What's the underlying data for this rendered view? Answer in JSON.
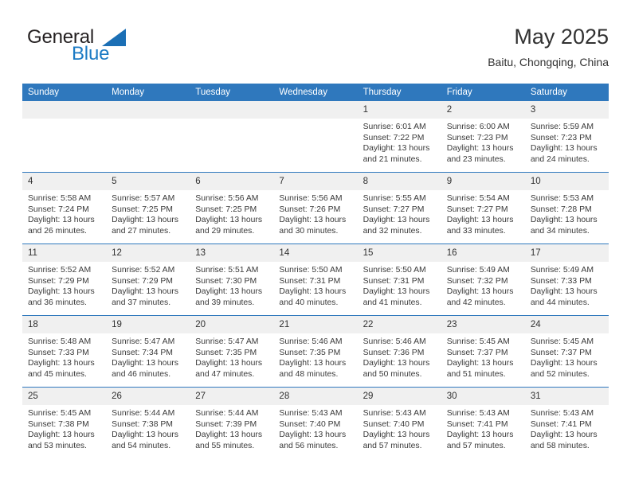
{
  "brand": {
    "word1": "General",
    "word2": "Blue",
    "triangle_color": "#1b6fb5"
  },
  "header": {
    "title": "May 2025",
    "subtitle": "Baitu, Chongqing, China"
  },
  "theme": {
    "header_blue": "#2f78bd",
    "daynum_gray": "#f0f0f0",
    "text": "#3a3a3a"
  },
  "weekdays": [
    "Sunday",
    "Monday",
    "Tuesday",
    "Wednesday",
    "Thursday",
    "Friday",
    "Saturday"
  ],
  "labels": {
    "sunrise_prefix": "Sunrise:",
    "sunset_prefix": "Sunset:",
    "daylight_prefix": "Daylight:"
  },
  "weeks": [
    [
      {
        "day": "",
        "sunrise": "",
        "sunset": "",
        "daylight_line1": "",
        "daylight_line2": ""
      },
      {
        "day": "",
        "sunrise": "",
        "sunset": "",
        "daylight_line1": "",
        "daylight_line2": ""
      },
      {
        "day": "",
        "sunrise": "",
        "sunset": "",
        "daylight_line1": "",
        "daylight_line2": ""
      },
      {
        "day": "",
        "sunrise": "",
        "sunset": "",
        "daylight_line1": "",
        "daylight_line2": ""
      },
      {
        "day": "1",
        "sunrise": "Sunrise: 6:01 AM",
        "sunset": "Sunset: 7:22 PM",
        "daylight_line1": "Daylight: 13 hours",
        "daylight_line2": "and 21 minutes."
      },
      {
        "day": "2",
        "sunrise": "Sunrise: 6:00 AM",
        "sunset": "Sunset: 7:23 PM",
        "daylight_line1": "Daylight: 13 hours",
        "daylight_line2": "and 23 minutes."
      },
      {
        "day": "3",
        "sunrise": "Sunrise: 5:59 AM",
        "sunset": "Sunset: 7:23 PM",
        "daylight_line1": "Daylight: 13 hours",
        "daylight_line2": "and 24 minutes."
      }
    ],
    [
      {
        "day": "4",
        "sunrise": "Sunrise: 5:58 AM",
        "sunset": "Sunset: 7:24 PM",
        "daylight_line1": "Daylight: 13 hours",
        "daylight_line2": "and 26 minutes."
      },
      {
        "day": "5",
        "sunrise": "Sunrise: 5:57 AM",
        "sunset": "Sunset: 7:25 PM",
        "daylight_line1": "Daylight: 13 hours",
        "daylight_line2": "and 27 minutes."
      },
      {
        "day": "6",
        "sunrise": "Sunrise: 5:56 AM",
        "sunset": "Sunset: 7:25 PM",
        "daylight_line1": "Daylight: 13 hours",
        "daylight_line2": "and 29 minutes."
      },
      {
        "day": "7",
        "sunrise": "Sunrise: 5:56 AM",
        "sunset": "Sunset: 7:26 PM",
        "daylight_line1": "Daylight: 13 hours",
        "daylight_line2": "and 30 minutes."
      },
      {
        "day": "8",
        "sunrise": "Sunrise: 5:55 AM",
        "sunset": "Sunset: 7:27 PM",
        "daylight_line1": "Daylight: 13 hours",
        "daylight_line2": "and 32 minutes."
      },
      {
        "day": "9",
        "sunrise": "Sunrise: 5:54 AM",
        "sunset": "Sunset: 7:27 PM",
        "daylight_line1": "Daylight: 13 hours",
        "daylight_line2": "and 33 minutes."
      },
      {
        "day": "10",
        "sunrise": "Sunrise: 5:53 AM",
        "sunset": "Sunset: 7:28 PM",
        "daylight_line1": "Daylight: 13 hours",
        "daylight_line2": "and 34 minutes."
      }
    ],
    [
      {
        "day": "11",
        "sunrise": "Sunrise: 5:52 AM",
        "sunset": "Sunset: 7:29 PM",
        "daylight_line1": "Daylight: 13 hours",
        "daylight_line2": "and 36 minutes."
      },
      {
        "day": "12",
        "sunrise": "Sunrise: 5:52 AM",
        "sunset": "Sunset: 7:29 PM",
        "daylight_line1": "Daylight: 13 hours",
        "daylight_line2": "and 37 minutes."
      },
      {
        "day": "13",
        "sunrise": "Sunrise: 5:51 AM",
        "sunset": "Sunset: 7:30 PM",
        "daylight_line1": "Daylight: 13 hours",
        "daylight_line2": "and 39 minutes."
      },
      {
        "day": "14",
        "sunrise": "Sunrise: 5:50 AM",
        "sunset": "Sunset: 7:31 PM",
        "daylight_line1": "Daylight: 13 hours",
        "daylight_line2": "and 40 minutes."
      },
      {
        "day": "15",
        "sunrise": "Sunrise: 5:50 AM",
        "sunset": "Sunset: 7:31 PM",
        "daylight_line1": "Daylight: 13 hours",
        "daylight_line2": "and 41 minutes."
      },
      {
        "day": "16",
        "sunrise": "Sunrise: 5:49 AM",
        "sunset": "Sunset: 7:32 PM",
        "daylight_line1": "Daylight: 13 hours",
        "daylight_line2": "and 42 minutes."
      },
      {
        "day": "17",
        "sunrise": "Sunrise: 5:49 AM",
        "sunset": "Sunset: 7:33 PM",
        "daylight_line1": "Daylight: 13 hours",
        "daylight_line2": "and 44 minutes."
      }
    ],
    [
      {
        "day": "18",
        "sunrise": "Sunrise: 5:48 AM",
        "sunset": "Sunset: 7:33 PM",
        "daylight_line1": "Daylight: 13 hours",
        "daylight_line2": "and 45 minutes."
      },
      {
        "day": "19",
        "sunrise": "Sunrise: 5:47 AM",
        "sunset": "Sunset: 7:34 PM",
        "daylight_line1": "Daylight: 13 hours",
        "daylight_line2": "and 46 minutes."
      },
      {
        "day": "20",
        "sunrise": "Sunrise: 5:47 AM",
        "sunset": "Sunset: 7:35 PM",
        "daylight_line1": "Daylight: 13 hours",
        "daylight_line2": "and 47 minutes."
      },
      {
        "day": "21",
        "sunrise": "Sunrise: 5:46 AM",
        "sunset": "Sunset: 7:35 PM",
        "daylight_line1": "Daylight: 13 hours",
        "daylight_line2": "and 48 minutes."
      },
      {
        "day": "22",
        "sunrise": "Sunrise: 5:46 AM",
        "sunset": "Sunset: 7:36 PM",
        "daylight_line1": "Daylight: 13 hours",
        "daylight_line2": "and 50 minutes."
      },
      {
        "day": "23",
        "sunrise": "Sunrise: 5:45 AM",
        "sunset": "Sunset: 7:37 PM",
        "daylight_line1": "Daylight: 13 hours",
        "daylight_line2": "and 51 minutes."
      },
      {
        "day": "24",
        "sunrise": "Sunrise: 5:45 AM",
        "sunset": "Sunset: 7:37 PM",
        "daylight_line1": "Daylight: 13 hours",
        "daylight_line2": "and 52 minutes."
      }
    ],
    [
      {
        "day": "25",
        "sunrise": "Sunrise: 5:45 AM",
        "sunset": "Sunset: 7:38 PM",
        "daylight_line1": "Daylight: 13 hours",
        "daylight_line2": "and 53 minutes."
      },
      {
        "day": "26",
        "sunrise": "Sunrise: 5:44 AM",
        "sunset": "Sunset: 7:38 PM",
        "daylight_line1": "Daylight: 13 hours",
        "daylight_line2": "and 54 minutes."
      },
      {
        "day": "27",
        "sunrise": "Sunrise: 5:44 AM",
        "sunset": "Sunset: 7:39 PM",
        "daylight_line1": "Daylight: 13 hours",
        "daylight_line2": "and 55 minutes."
      },
      {
        "day": "28",
        "sunrise": "Sunrise: 5:43 AM",
        "sunset": "Sunset: 7:40 PM",
        "daylight_line1": "Daylight: 13 hours",
        "daylight_line2": "and 56 minutes."
      },
      {
        "day": "29",
        "sunrise": "Sunrise: 5:43 AM",
        "sunset": "Sunset: 7:40 PM",
        "daylight_line1": "Daylight: 13 hours",
        "daylight_line2": "and 57 minutes."
      },
      {
        "day": "30",
        "sunrise": "Sunrise: 5:43 AM",
        "sunset": "Sunset: 7:41 PM",
        "daylight_line1": "Daylight: 13 hours",
        "daylight_line2": "and 57 minutes."
      },
      {
        "day": "31",
        "sunrise": "Sunrise: 5:43 AM",
        "sunset": "Sunset: 7:41 PM",
        "daylight_line1": "Daylight: 13 hours",
        "daylight_line2": "and 58 minutes."
      }
    ]
  ]
}
